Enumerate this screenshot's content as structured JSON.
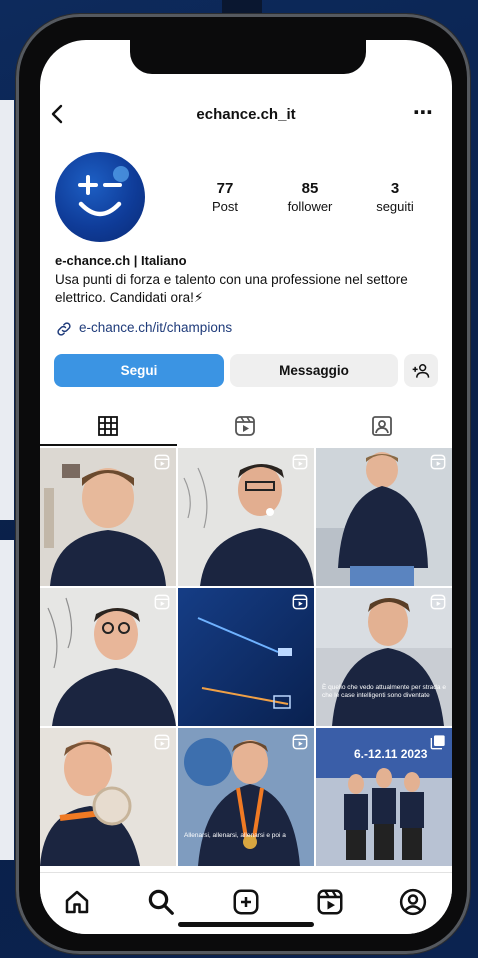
{
  "profile": {
    "username": "echance.ch_it",
    "name": "e-chance.ch | Italiano",
    "bio": "Usa punti di forza e talento con una professione nel settore elettrico. Candidati ora!⚡",
    "link": "e-chance.ch/it/champions"
  },
  "stats": [
    {
      "value": "77",
      "label": "Post"
    },
    {
      "value": "85",
      "label": "follower"
    },
    {
      "value": "3",
      "label": "seguiti"
    }
  ],
  "buttons": {
    "follow": "Segui",
    "message": "Messaggio"
  },
  "grid": {
    "captions": [
      "",
      "",
      "",
      "",
      "",
      "È quello che vedo attualmente per strada e che le case intelligenti sono diventate",
      "",
      "Allenarsi, allenarsi, allenarsi e poi a",
      ""
    ],
    "poster_text": "6.-12.11 2023"
  },
  "colors": {
    "accent": "#3b94e3",
    "shirt": "#1b2540"
  },
  "icons": [
    "back-icon",
    "more-icon",
    "grid-icon",
    "reels-icon",
    "tagged-icon",
    "link-icon",
    "add-person-icon",
    "home-icon",
    "search-icon",
    "create-icon",
    "reels-nav-icon",
    "profile-icon"
  ]
}
